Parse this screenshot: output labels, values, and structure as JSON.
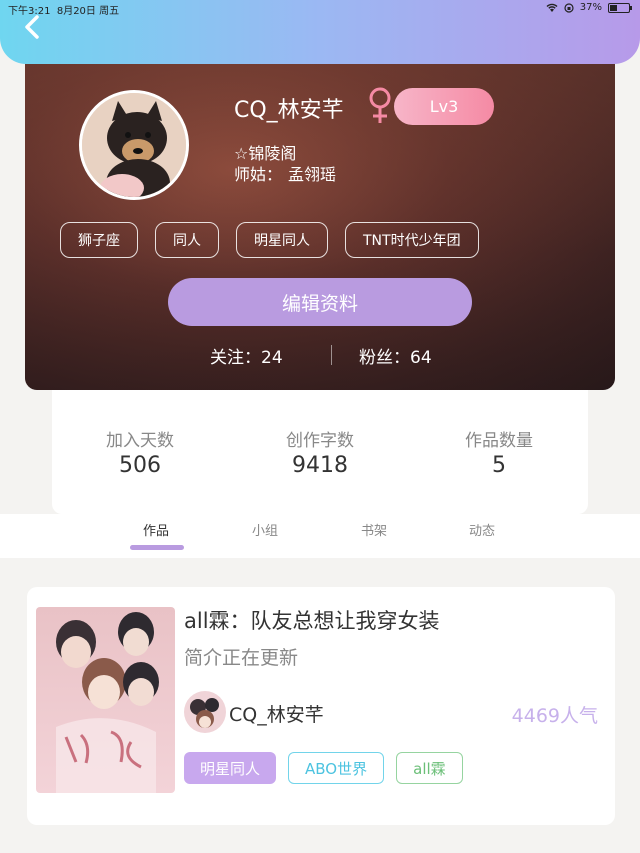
{
  "status_bar": {
    "time": "下午3:21",
    "date": "8月20日 周五",
    "battery": "37%"
  },
  "profile": {
    "username": "CQ_林安芊",
    "level": "Lv3",
    "guild": "☆锦陵阁",
    "mentor_label": "师姑：",
    "mentor_name": "孟翎瑶",
    "tags": [
      "狮子座",
      "同人",
      "明星同人",
      "TNT时代少年团"
    ],
    "edit_button": "编辑资料",
    "following_label": "关注：",
    "following_count": "24",
    "followers_label": "粉丝：",
    "followers_count": "64"
  },
  "stats": [
    {
      "label": "加入天数",
      "value": "506"
    },
    {
      "label": "创作字数",
      "value": "9418"
    },
    {
      "label": "作品数量",
      "value": "5"
    }
  ],
  "tabs": [
    {
      "label": "作品",
      "active": true
    },
    {
      "label": "小组",
      "active": false
    },
    {
      "label": "书架",
      "active": false
    },
    {
      "label": "动态",
      "active": false
    }
  ],
  "work": {
    "title": "all霖：队友总想让我穿女装",
    "description": "简介正在更新",
    "author": "CQ_林安芊",
    "popularity": "4469人气",
    "tags": [
      "明星同人",
      "ABO世界",
      "all霖"
    ]
  },
  "colors": {
    "accent": "#b99be0",
    "level_badge": "#f58aa4",
    "popularity": "#c7b1eb"
  }
}
